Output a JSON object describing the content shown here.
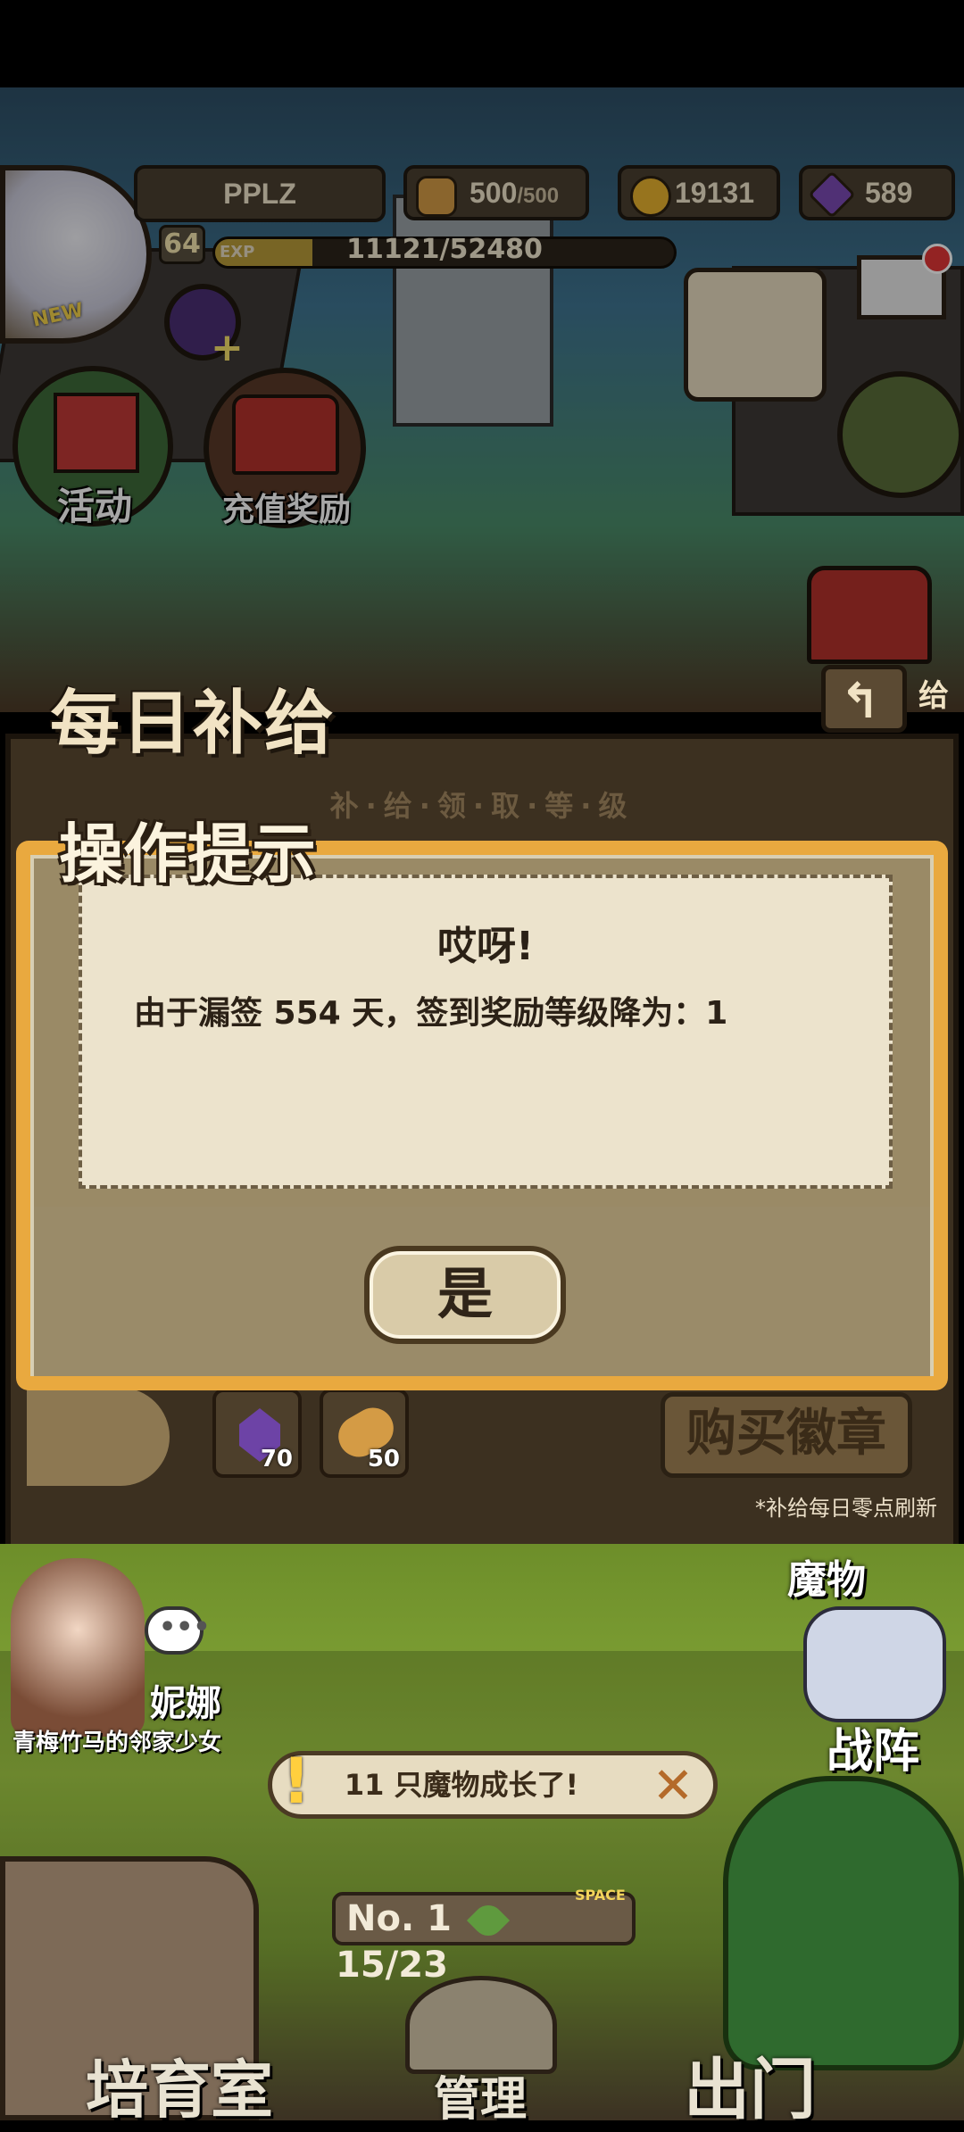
{
  "hud": {
    "player_name": "PPLZ",
    "level": "64",
    "new_tag": "NEW",
    "exp_label": "EXP",
    "exp_value": "11121/52480",
    "exp_progress": 0.212,
    "bread_current": "500",
    "bread_max": "/500",
    "gold": "19131",
    "gems": "589"
  },
  "menu": {
    "activity": "活动",
    "recharge_reward": "充值奖励"
  },
  "daily_supply": {
    "title": "每日补给",
    "back_label": "给",
    "subtitle": "补·给·领·取·等·级",
    "rewards": [
      {
        "icon": "gem-icon",
        "count": "70"
      },
      {
        "icon": "bread-icon",
        "count": "50"
      }
    ],
    "buy_badge": "购买徽章",
    "refresh_note": "*补给每日零点刷新"
  },
  "dialog": {
    "title": "操作提示",
    "heading": "哎呀!",
    "message": "由于漏签 554 天，签到奖励等级降为：1",
    "yes_button": "是"
  },
  "bottom": {
    "character_name": "妮娜",
    "character_desc": "青梅竹马的邻家少女",
    "notice": "11 只魔物成长了!",
    "rank_label": "No. 1",
    "space_label": "SPACE",
    "space_value": "15/23",
    "monster": "魔物",
    "formation": "战阵",
    "tabs": [
      "培育室",
      "管理",
      "出门"
    ]
  },
  "colors": {
    "dialog_border": "#e9a93f",
    "paper": "#ece3cc",
    "panel": "#3c3020"
  }
}
